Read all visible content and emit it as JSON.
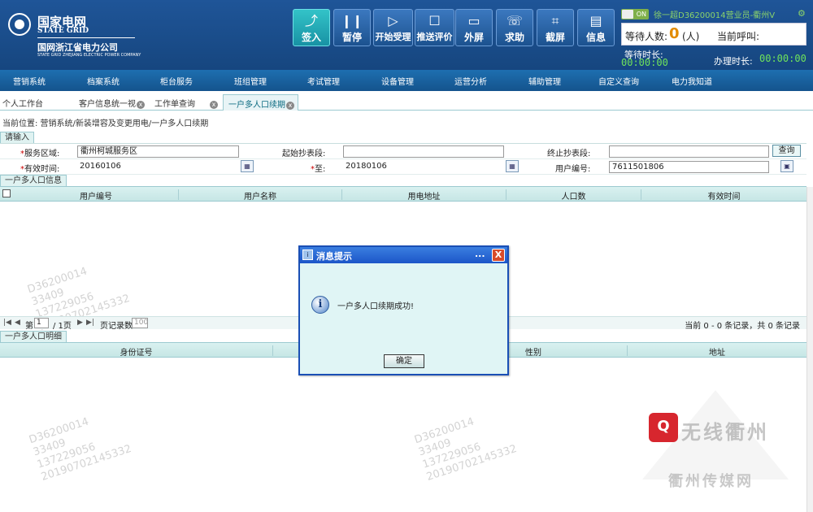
{
  "header": {
    "logo_cn": "国家电网",
    "logo_en": "STATE GRID",
    "company": "国网浙江省电力公司",
    "company_en": "STATE GRID ZHEJIANG ELECTRIC POWER COMPANY"
  },
  "toolbar": [
    {
      "label": "签入",
      "icon": "sign-in-icon",
      "glyph": "⤴"
    },
    {
      "label": "暂停",
      "icon": "pause-icon",
      "glyph": "❙❙"
    },
    {
      "label": "开始受理",
      "icon": "play-icon",
      "glyph": "▷"
    },
    {
      "label": "推送评价",
      "icon": "chat-icon",
      "glyph": "☐"
    },
    {
      "label": "外屏",
      "icon": "monitor-icon",
      "glyph": "▭"
    },
    {
      "label": "求助",
      "icon": "phone-icon",
      "glyph": "☏"
    },
    {
      "label": "截屏",
      "icon": "crop-icon",
      "glyph": "⌗"
    },
    {
      "label": "信息",
      "icon": "document-icon",
      "glyph": "▤"
    }
  ],
  "status": {
    "toggle": "ON",
    "user": "徐一超D36200014营业员-衢州V",
    "waiting_label": "等待人数:",
    "waiting_count": "0",
    "waiting_unit": "(人)",
    "current_call_label": "当前呼叫:",
    "wait_time_label": "等待时长:",
    "wait_time": "00:00:00",
    "handle_time_label": "办理时长:",
    "handle_time": "00:00:00"
  },
  "menu": [
    "营销系统",
    "档案系统",
    "柜台服务",
    "班组管理",
    "考试管理",
    "设备管理",
    "运营分析",
    "辅助管理",
    "自定义查询",
    "电力我知道"
  ],
  "tabs": [
    {
      "label": "个人工作台"
    },
    {
      "label": "客户信息统一视"
    },
    {
      "label": "工作单查询"
    },
    {
      "label": "一户多人口续期"
    }
  ],
  "breadcrumb": "当前位置: 营销系统/新装增容及变更用电/一户多人口续期",
  "form": {
    "section": "请输入",
    "service_area_label": "服务区域:",
    "service_area": "衢州柯城服务区",
    "start_seg_label": "起始抄表段:",
    "start_seg": "",
    "end_seg_label": "终止抄表段:",
    "end_seg": "",
    "query_label": "查询",
    "valid_time_label": "有效时间:",
    "valid_from": "20160106",
    "to_label": "至:",
    "valid_to": "20180106",
    "user_no_label": "用户编号:",
    "user_no": "7611501806"
  },
  "grid1": {
    "section": "一户多人口信息",
    "columns": [
      "用户编号",
      "用户名称",
      "用电地址",
      "人口数",
      "有效时间"
    ]
  },
  "pager": {
    "page_prefix": "第",
    "page": "1",
    "page_total": "/ 1页",
    "per_page_label": "页记录数",
    "per_page": "100",
    "info": "当前 0 - 0 条记录，共 0 条记录"
  },
  "grid2": {
    "section": "一户多人口明细",
    "columns": [
      "身份证号",
      "",
      "性别",
      "地址"
    ]
  },
  "dialog": {
    "title": "消息提示",
    "dots": "...",
    "close": "X",
    "message": "一户多人口续期成功!",
    "ok": "确定"
  },
  "watermark": "D36200014\n33409\n137229056\n20190702145332",
  "brand": {
    "logo": "无线衢州",
    "sub": "衢州传媒网"
  }
}
